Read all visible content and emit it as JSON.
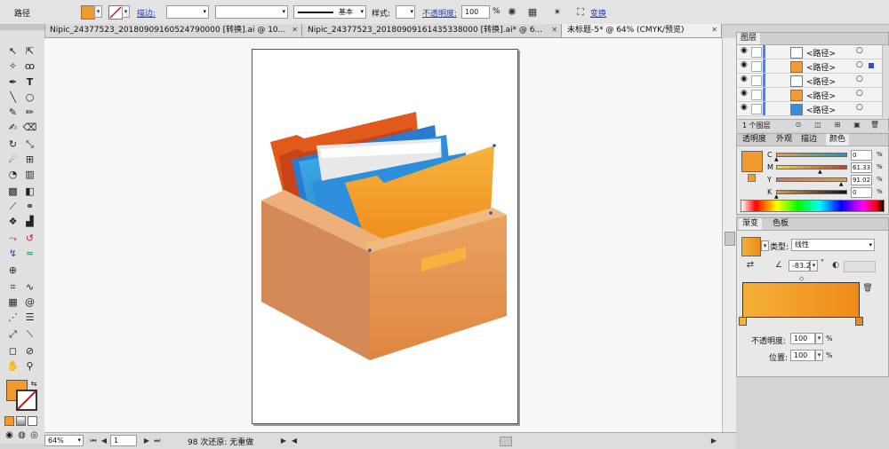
{
  "control_bar": {
    "object_type": "路径",
    "fill_color": "#f19a2e",
    "stroke_label": "描边:",
    "stroke_line": "基本",
    "style_label": "样式:",
    "opacity_label": "不透明度:",
    "opacity_value": "100",
    "opacity_unit": "%",
    "transform_label": "变换"
  },
  "tabs": [
    {
      "label": "Nipic_24377523_20180909160524790000 [转换].ai @ 10...",
      "active": false
    },
    {
      "label": "Nipic_24377523_20180909161435338000 [转换].ai* @ 6...",
      "active": false
    },
    {
      "label": "未标题-5* @ 64% (CMYK/预览)",
      "active": true
    }
  ],
  "status": {
    "zoom": "64%",
    "page": "1",
    "status_text": "98 次还原: 无重做"
  },
  "layers_panel": {
    "title": "图层",
    "rows": [
      {
        "name": "<路径>",
        "color": "#ffffff"
      },
      {
        "name": "<路径>",
        "color": "#f19a2e"
      },
      {
        "name": "<路径>",
        "color": "#ffffff"
      },
      {
        "name": "<路径>",
        "color": "#f19a2e"
      },
      {
        "name": "<路径>",
        "color": "#3a8fd8"
      }
    ],
    "footer": "1 个图层"
  },
  "color_panel": {
    "tabs": [
      "透明度",
      "外观",
      "描边",
      "颜色"
    ],
    "active_tab": "颜色",
    "swatch": "#f19a2e",
    "channels": [
      {
        "label": "C",
        "value": "0",
        "pct": 0
      },
      {
        "label": "M",
        "value": "61.33",
        "pct": 61.33
      },
      {
        "label": "Y",
        "value": "91.02",
        "pct": 91.02
      },
      {
        "label": "K",
        "value": "0",
        "pct": 0
      }
    ],
    "unit": "%"
  },
  "gradient_panel": {
    "tabs": [
      "渐变",
      "色板"
    ],
    "active_tab": "渐变",
    "type_label": "类型:",
    "type_value": "线性",
    "angle_value": "-83.2",
    "angle_unit": "°",
    "start_color": "#f5b03a",
    "end_color": "#ee8a18",
    "opacity_label": "不透明度:",
    "opacity_value": "100",
    "location_label": "位置:",
    "location_value": "100",
    "unit": "%"
  }
}
